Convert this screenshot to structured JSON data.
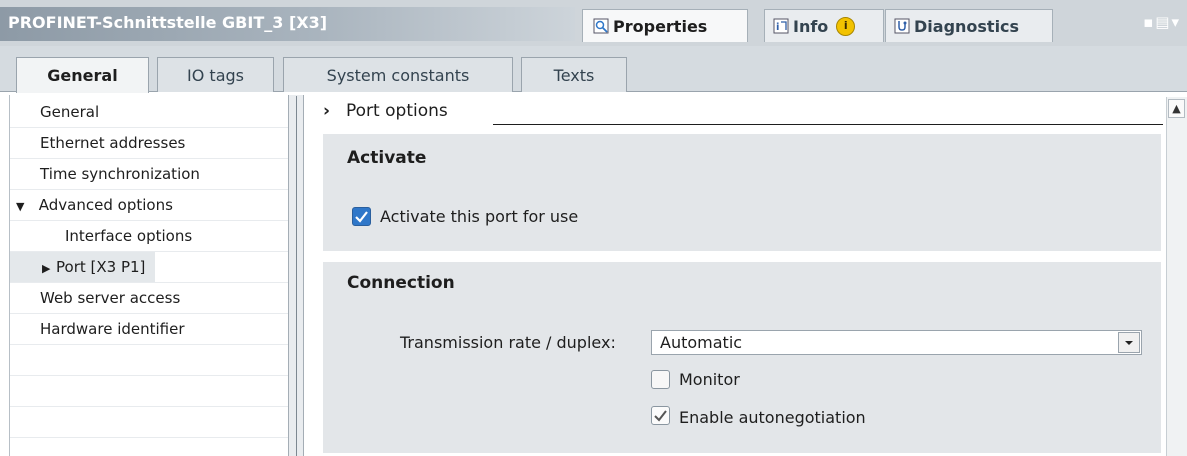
{
  "window": {
    "title": "PROFINET-Schnittstelle GBIT_3 [X3]",
    "tabs": [
      {
        "label": "Properties",
        "icon": "properties-icon"
      },
      {
        "label": "Info",
        "icon": "info-icon"
      },
      {
        "label": "Diagnostics",
        "icon": "diagnostics-icon"
      }
    ],
    "info_badge": "i"
  },
  "subtabs": [
    "General",
    "IO tags",
    "System constants",
    "Texts"
  ],
  "nav": {
    "items": [
      {
        "label": "General"
      },
      {
        "label": "Ethernet addresses"
      },
      {
        "label": "Time synchronization"
      },
      {
        "label": "Advanced options",
        "expander": "expanded"
      },
      {
        "label": "Interface options"
      },
      {
        "label": "Port [X3 P1]",
        "expander": "collapsed",
        "selected": true
      },
      {
        "label": "Web server access"
      },
      {
        "label": "Hardware identifier"
      }
    ]
  },
  "content": {
    "section": {
      "marker": "›",
      "title": "Port options"
    },
    "activate": {
      "title": "Activate",
      "checkbox_label": "Activate this port for use",
      "checked": true
    },
    "connection": {
      "title": "Connection",
      "rate_label": "Transmission rate / duplex:",
      "rate_value": "Automatic",
      "monitor_label": "Monitor",
      "monitor_checked": false,
      "autoneg_label": "Enable autonegotiation",
      "autoneg_checked": true
    }
  },
  "colors": {
    "accent": "#2f77c9",
    "panel": "#e3e6e9"
  }
}
